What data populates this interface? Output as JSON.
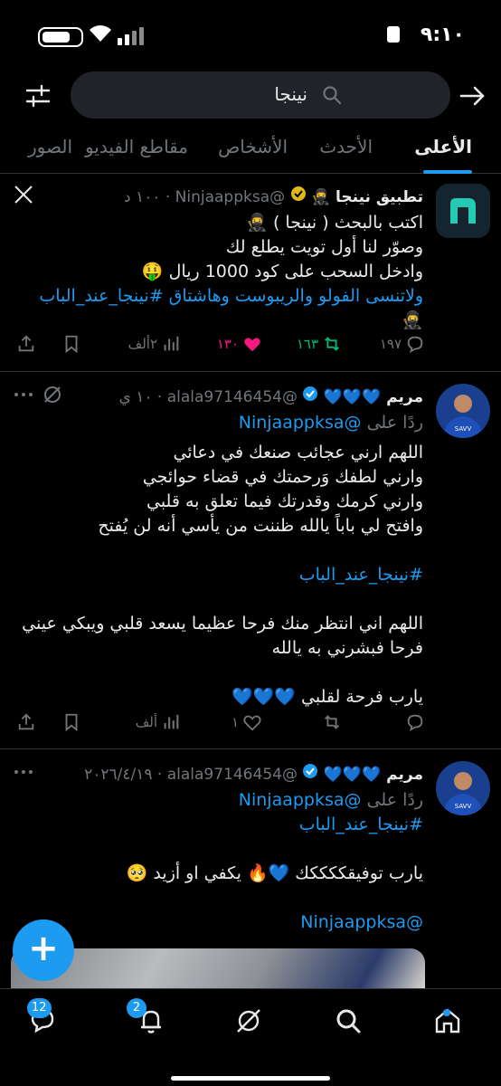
{
  "status_bar": {
    "time": "٩:١٠"
  },
  "search": {
    "query": "نينجا"
  },
  "tabs": [
    {
      "label": "الأعلى",
      "active": true
    },
    {
      "label": "الأحدث"
    },
    {
      "label": "الأشخاص"
    },
    {
      "label": "مقاطع الفيديو"
    },
    {
      "label": "الصور"
    }
  ],
  "posts": [
    {
      "name": "تطبيق نينجا 🥷",
      "handle": "@Ninjaappksa",
      "time": "١٠٠ د",
      "body": [
        "اكتب بالبحث ( نينجا ) 🥷",
        "وصوّر لنا أول تويت يطلع لك",
        "وادخل السحب على كود 1000 ريال 🤑",
        "ولاتنسى الفولو والريبوست وهاشتاق #نينجا_عند_الباب",
        "🥷"
      ],
      "hashtag": "#نينجا_عند_الباب",
      "replies": "١٩٧",
      "reposts": "١٦٣",
      "likes": "١٣٠",
      "views": "٢ألف"
    },
    {
      "name": "مريم 💙💙💙",
      "handle": "@alala97146454",
      "time": "١٠ ي",
      "reply_to_label": "ردًا على",
      "reply_to": "@Ninjaappksa",
      "body": [
        "اللهم ارني عجائب صنعك في دعائي",
        "وارني لطفك وَرحمتك في قضاء حوائجي",
        "وارني كرمك وقدرتك فيما تعلق به قلبي",
        "وافتح لي باباً يالله ظننت من يأسي أنه لن يُفتح",
        "",
        "#نينجا_عند_الباب",
        "",
        "اللهم اني انتظر منك فرحا عظيما يسعد قلبي ويبكي عيني",
        "فرحا فبشرني به يالله",
        "",
        "يارب فرحة لقلبي 💙💙💙"
      ],
      "hashtag": "#نينجا_عند_الباب",
      "replies": "",
      "reposts": "",
      "likes": "١",
      "views": "ألف"
    },
    {
      "name": "مريم 💙💙💙",
      "handle": "@alala97146454",
      "time": "٢٠٢٦/٤/١٩",
      "reply_to_label": "ردًا على",
      "reply_to": "@Ninjaappksa",
      "body": [
        "#نينجا_عند_الباب",
        "",
        "يارب توفيقككككك 💙🔥 يكفي او أزيد 🥺",
        "",
        "@Ninjaappksa"
      ],
      "hashtag": "#نينجا_عند_الباب",
      "mention": "@Ninjaappksa"
    }
  ],
  "bottom_nav": {
    "messages_badge": "12",
    "notifications_badge": "2",
    "items": [
      "home-icon",
      "search-icon",
      "grok-icon",
      "notifications-icon",
      "messages-icon"
    ]
  },
  "colors": {
    "accent": "#1d9bf0",
    "background": "#000000",
    "muted": "#71767b",
    "like": "#f91880",
    "repost": "#00ba7c"
  }
}
